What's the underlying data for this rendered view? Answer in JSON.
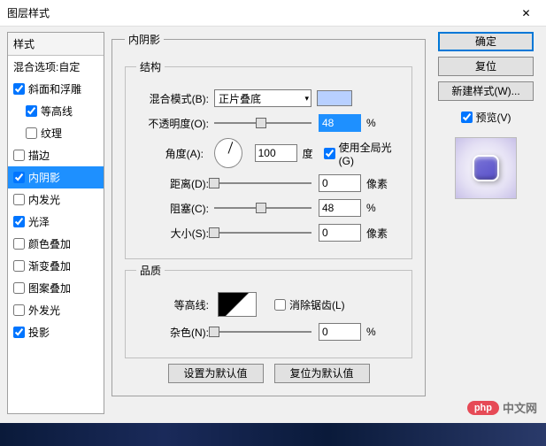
{
  "window": {
    "title": "图层样式",
    "close": "✕"
  },
  "left": {
    "header": "样式",
    "blend": "混合选项:自定",
    "items": [
      {
        "label": "斜面和浮雕",
        "checked": true,
        "selected": false,
        "indent": false
      },
      {
        "label": "等高线",
        "checked": true,
        "selected": false,
        "indent": true
      },
      {
        "label": "纹理",
        "checked": false,
        "selected": false,
        "indent": true
      },
      {
        "label": "描边",
        "checked": false,
        "selected": false,
        "indent": false
      },
      {
        "label": "内阴影",
        "checked": true,
        "selected": true,
        "indent": false
      },
      {
        "label": "内发光",
        "checked": false,
        "selected": false,
        "indent": false
      },
      {
        "label": "光泽",
        "checked": true,
        "selected": false,
        "indent": false
      },
      {
        "label": "颜色叠加",
        "checked": false,
        "selected": false,
        "indent": false
      },
      {
        "label": "渐变叠加",
        "checked": false,
        "selected": false,
        "indent": false
      },
      {
        "label": "图案叠加",
        "checked": false,
        "selected": false,
        "indent": false
      },
      {
        "label": "外发光",
        "checked": false,
        "selected": false,
        "indent": false
      },
      {
        "label": "投影",
        "checked": true,
        "selected": false,
        "indent": false
      }
    ]
  },
  "center": {
    "panel_title": "内阴影",
    "structure": {
      "legend": "结构",
      "blend_mode_label": "混合模式(B):",
      "blend_mode_value": "正片叠底",
      "opacity_label": "不透明度(O):",
      "opacity_value": "48",
      "opacity_unit": "%",
      "angle_label": "角度(A):",
      "angle_value": "100",
      "angle_unit": "度",
      "global_light_label": "使用全局光(G)",
      "global_light_checked": true,
      "distance_label": "距离(D):",
      "distance_value": "0",
      "distance_unit": "像素",
      "choke_label": "阻塞(C):",
      "choke_value": "48",
      "choke_unit": "%",
      "size_label": "大小(S):",
      "size_value": "0",
      "size_unit": "像素"
    },
    "quality": {
      "legend": "品质",
      "contour_label": "等高线:",
      "antialias_label": "消除锯齿(L)",
      "antialias_checked": false,
      "noise_label": "杂色(N):",
      "noise_value": "0",
      "noise_unit": "%"
    },
    "buttons": {
      "default": "设置为默认值",
      "reset": "复位为默认值"
    }
  },
  "right": {
    "ok": "确定",
    "reset": "复位",
    "new_style": "新建样式(W)...",
    "preview_label": "预览(V)",
    "preview_checked": true
  },
  "watermark": {
    "badge": "php",
    "text": "中文网"
  }
}
